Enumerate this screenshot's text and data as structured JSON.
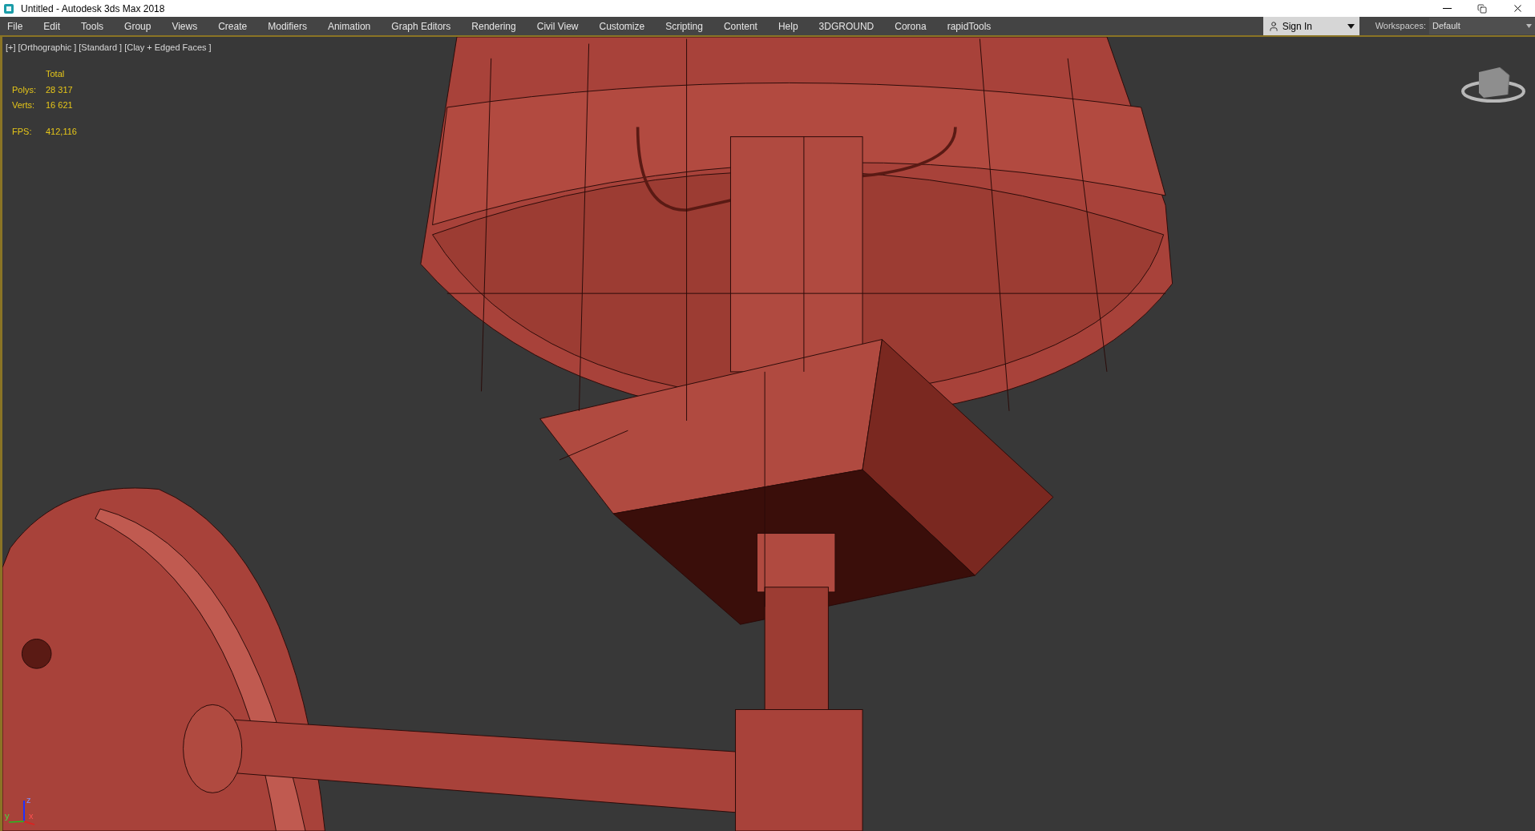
{
  "window": {
    "title": "Untitled - Autodesk 3ds Max 2018"
  },
  "menu": [
    "File",
    "Edit",
    "Tools",
    "Group",
    "Views",
    "Create",
    "Modifiers",
    "Animation",
    "Graph Editors",
    "Rendering",
    "Civil View",
    "Customize",
    "Scripting",
    "Content",
    "Help",
    "3DGROUND",
    "Corona",
    "rapidTools"
  ],
  "sign_in": {
    "label": "Sign In"
  },
  "workspaces": {
    "label": "Workspaces:",
    "value": "Default"
  },
  "viewport": {
    "active": true,
    "labels": [
      "[+]",
      "[Orthographic ]",
      "[Standard ]",
      "[Clay + Edged Faces ]"
    ],
    "stats": {
      "header": "Total",
      "rows": [
        {
          "label": "Polys:",
          "value": "28 317"
        },
        {
          "label": "Verts:",
          "value": "16 621"
        }
      ],
      "fps_label": "FPS:",
      "fps_value": "412,116"
    },
    "axes": [
      "z",
      "y",
      "x"
    ]
  }
}
